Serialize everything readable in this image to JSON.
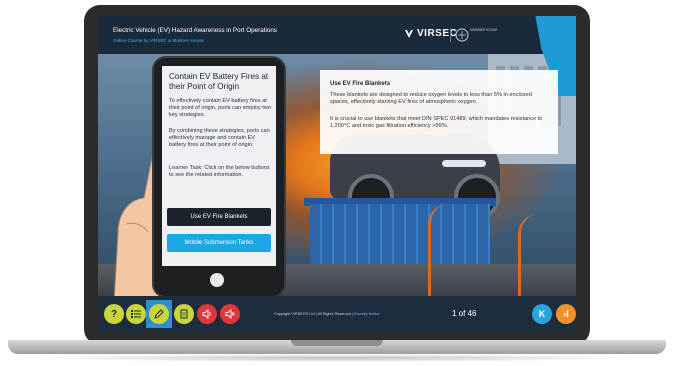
{
  "header": {
    "course_title": "Electric Vehicle (EV) Hazard Awareness in Port Operations",
    "course_subtitle": "Online Course by VIRSEC & Marimer House",
    "logo_text": "VIRSEC",
    "partner_text": "MARIMER HOUSE"
  },
  "tablet": {
    "title": "Contain EV Battery Fires at their Point of Origin",
    "paragraph_1": "To effectively contain EV battery fires at their point of origin, ports can employ two key strategies.",
    "paragraph_2": "By combining these strategies, ports can effectively manage and contain EV battery fires at their point of origin.",
    "learner_task": "Learner Task: Click on the below buttons to see the related information.",
    "button_fire_blankets": "Use EV Fire Blankets",
    "button_submersion": "Mobile Submersion Tanks"
  },
  "info_panel": {
    "title": "Use EV Fire Blankets",
    "paragraph_1": "These blankets are designed to reduce oxygen levels to less than 5% in enclosed spaces, effectively starving EV fires of atmospheric oxygen.",
    "paragraph_2": "It is crucial to use blankets that meet DIN SPEC 91489, which mandates resistance to 1,200°C and toxic gas filtration efficiency >99%."
  },
  "footer": {
    "help_label": "?",
    "copyright": "Copyright VIRSEC® Ltd | All Rights Reserved |",
    "copyright_link": "Security Notice",
    "page_indicator": "1 of 46",
    "back_label": "K",
    "next_label": "›I"
  },
  "colors": {
    "header_bg": "#1b2a3a",
    "accent_blue": "#1ba7e6",
    "footer_yellow": "#c9d43a",
    "footer_red": "#e0373b",
    "next_orange": "#f0912e"
  },
  "icons": [
    "help-icon",
    "menu-list-icon",
    "pencil-icon",
    "notes-icon",
    "audio-icon",
    "mute-icon",
    "back-icon",
    "next-icon"
  ]
}
